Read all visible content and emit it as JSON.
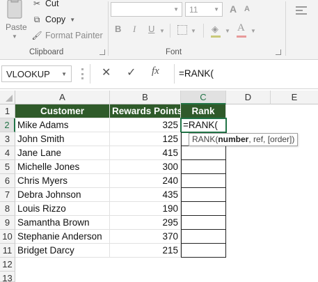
{
  "ribbon": {
    "clipboard": {
      "paste_label": "Paste",
      "cut_label": "Cut",
      "copy_label": "Copy",
      "format_painter_label": "Format Painter",
      "group_label": "Clipboard"
    },
    "font": {
      "font_name": "",
      "font_size": "11",
      "grow_label": "A",
      "shrink_label": "A",
      "bold_label": "B",
      "italic_label": "I",
      "underline_label": "U",
      "font_color_label": "A",
      "group_label": "Font"
    }
  },
  "formula_bar": {
    "name_box": "VLOOKUP",
    "cancel_icon": "✕",
    "enter_icon": "✓",
    "fx_label": "fx",
    "formula": "=RANK("
  },
  "grid": {
    "columns": [
      "A",
      "B",
      "C",
      "D",
      "E"
    ],
    "rows": [
      "1",
      "2",
      "3",
      "4",
      "5",
      "6",
      "7",
      "8",
      "9",
      "10",
      "11",
      "12",
      "13"
    ],
    "header": {
      "customer": "Customer",
      "points": "Rewards Points",
      "rank": "Rank"
    },
    "data": [
      {
        "customer": "Mike Adams",
        "points": "325",
        "rank": "=RANK("
      },
      {
        "customer": "John Smith",
        "points": "125",
        "rank": ""
      },
      {
        "customer": "Jane Lane",
        "points": "415",
        "rank": ""
      },
      {
        "customer": "Michelle Jones",
        "points": "300",
        "rank": ""
      },
      {
        "customer": "Chris Myers",
        "points": "240",
        "rank": ""
      },
      {
        "customer": "Debra Johnson",
        "points": "435",
        "rank": ""
      },
      {
        "customer": "Louis Rizzo",
        "points": "190",
        "rank": ""
      },
      {
        "customer": "Samantha Brown",
        "points": "295",
        "rank": ""
      },
      {
        "customer": "Stephanie Anderson",
        "points": "370",
        "rank": ""
      },
      {
        "customer": "Bridget Darcy",
        "points": "215",
        "rank": ""
      }
    ]
  },
  "tooltip": {
    "fn": "RANK(",
    "arg_bold": "number",
    "rest": ", ref, [order])"
  },
  "colors": {
    "header_fill": "#2f5a2a",
    "selection_green": "#217346"
  }
}
